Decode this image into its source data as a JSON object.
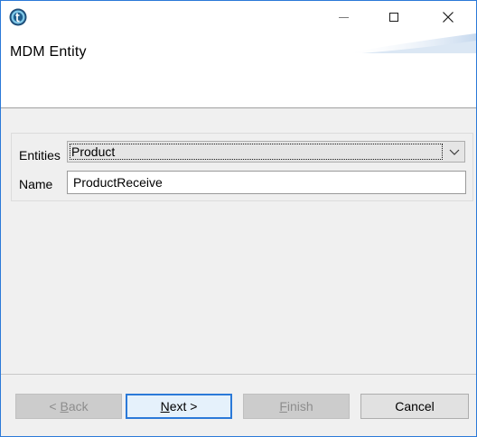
{
  "window": {
    "icon": "talend-app-icon",
    "controls": {
      "minimize": "minimize-icon",
      "maximize": "maximize-icon",
      "close": "close-icon"
    }
  },
  "header": {
    "title": "MDM Entity"
  },
  "form": {
    "entities_label": "Entities",
    "entities_value": "Product",
    "name_label": "Name",
    "name_value": "ProductReceive"
  },
  "buttons": {
    "back": {
      "prefix": "< ",
      "mnemonic": "B",
      "rest": "ack",
      "enabled": false
    },
    "next": {
      "mnemonic": "N",
      "rest": "ext >",
      "enabled": true
    },
    "finish": {
      "mnemonic": "F",
      "rest": "inish",
      "enabled": false
    },
    "cancel": {
      "label": "Cancel",
      "enabled": true
    }
  },
  "colors": {
    "accent": "#2b79d8",
    "dialog_bg": "#f0f0f0",
    "disabled_text": "#8d8d8d"
  }
}
